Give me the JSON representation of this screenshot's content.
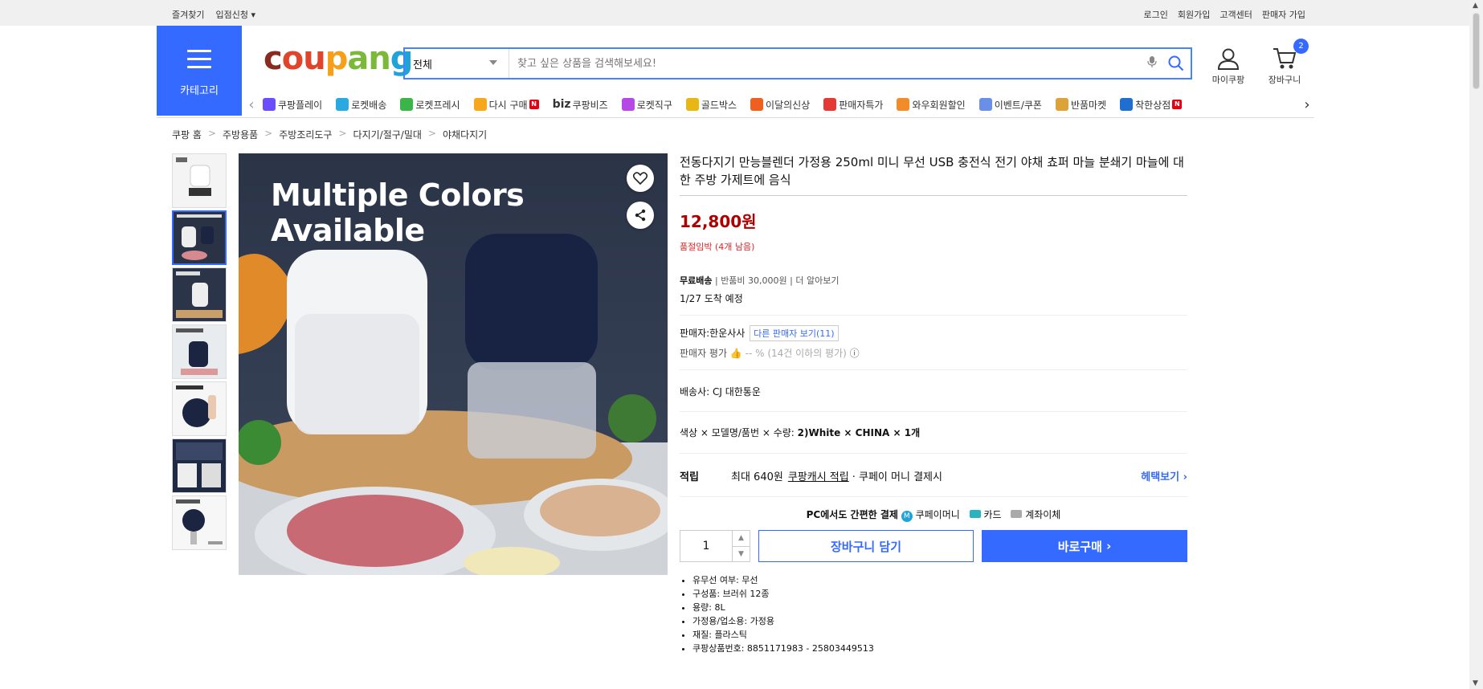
{
  "topbar": {
    "bookmark": "즐겨찾기",
    "apply": "입점신청",
    "login": "로그인",
    "signup": "회원가입",
    "cs": "고객센터",
    "seller": "판매자 가입"
  },
  "category": "카테고리",
  "logo": "coupang",
  "search": {
    "scope": "전체",
    "placeholder": "찾고 싶은 상품을 검색해보세요!"
  },
  "user": {
    "mypage": "마이쿠팡",
    "cart": "장바구니",
    "cart_count": "2"
  },
  "nav": {
    "items": [
      {
        "label": "쿠팡플레이",
        "color": "#6b4cff"
      },
      {
        "label": "로켓배송",
        "color": "#2aa8e0"
      },
      {
        "label": "로켓프레시",
        "color": "#3bb54a"
      },
      {
        "label": "다시 구매",
        "color": "#f7a71c",
        "new": "N"
      },
      {
        "label": "쿠팡비즈",
        "prefix": "biz"
      },
      {
        "label": "로켓직구",
        "color": "#b648e6"
      },
      {
        "label": "골드박스",
        "color": "#e8b617"
      },
      {
        "label": "이달의신상",
        "color": "#ef6020"
      },
      {
        "label": "판매자특가",
        "color": "#e53935"
      },
      {
        "label": "와우회원할인",
        "color": "#f28c28"
      },
      {
        "label": "이벤트/쿠폰",
        "color": "#6a8fe8"
      },
      {
        "label": "반품마켓",
        "color": "#dca33a"
      },
      {
        "label": "착한상점",
        "color": "#1f6fd1",
        "new": "N"
      }
    ]
  },
  "breadcrumb": [
    "쿠팡 홈",
    "주방용품",
    "주방조리도구",
    "다지기/절구/밀대",
    "야채다지기"
  ],
  "main_image": {
    "title": "Multiple Colors Available"
  },
  "product": {
    "title": "전동다지기 만능블렌더 가정용 250ml 미니 무선 USB 충전식 전기 야채 쵸퍼 마늘 분쇄기 마늘에 대한 주방 가제트에 음식",
    "price": "12,800원",
    "stock": "품절임박 (4개 남음)",
    "free_ship": "무료배송",
    "return_fee": "반품비 30,000원",
    "learn_more": "더 알아보기",
    "arrival": "1/27 도착 예정",
    "seller_label": "판매자:",
    "seller_name": "한운사사",
    "other_sellers": "다른 판매자 보기(11)",
    "seller_rating_label": "판매자 평가",
    "seller_rating": "-- % (14건 이하의 평가)",
    "carrier": "배송사:  CJ 대한통운",
    "option": "색상 × 모델명/품번 × 수량:",
    "option_value": "2)White × CHINA × 1개",
    "points_label": "적립",
    "points_max": "최대 640원",
    "points_cash": "쿠팡캐시 적립",
    "points_pay": "· 쿠페이 머니 결제시",
    "benefits": "헤택보기",
    "pay_text": "PC에서도 간편한 결제",
    "pay_coupay": "쿠페이머니",
    "pay_card": "카드",
    "pay_bank": "계좌이체",
    "qty": "1",
    "cart_btn": "장바구니 담기",
    "buy_btn": "바로구매",
    "specs": [
      "유무선 여부: 무선",
      "구성품: 브러쉬 12종",
      "용량: 8L",
      "가정용/업소용: 가정용",
      "재질: 플라스틱",
      "쿠팡상품번호: 8851171983 - 25803449513"
    ]
  }
}
